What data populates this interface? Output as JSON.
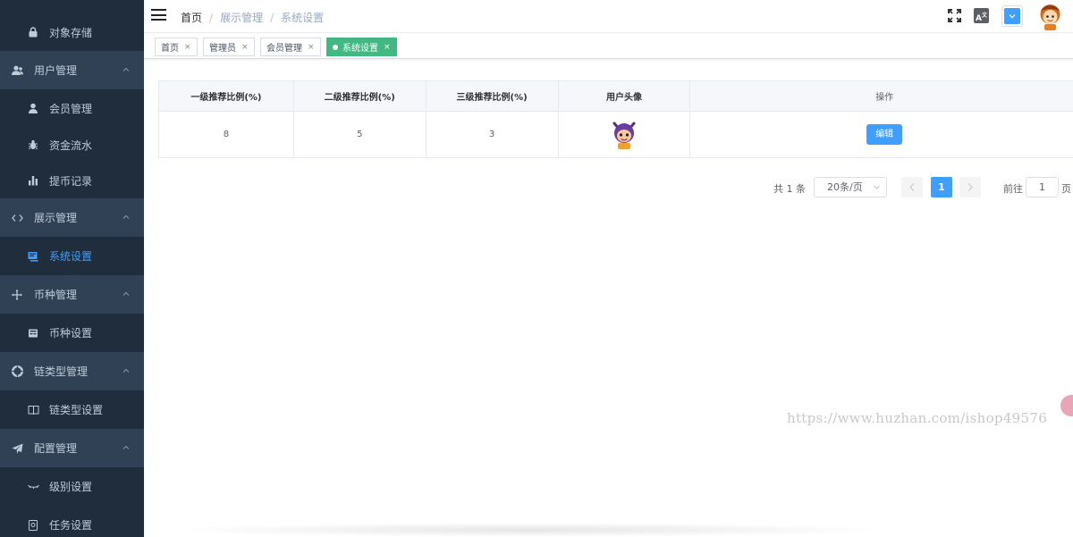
{
  "sidebar": {
    "partial_item": "",
    "items": [
      {
        "type": "sub",
        "label": "对象存储",
        "icon": "lock-icon"
      },
      {
        "type": "group",
        "label": "用户管理",
        "icon": "user-icon"
      },
      {
        "type": "sub",
        "label": "会员管理",
        "icon": "person-icon"
      },
      {
        "type": "sub",
        "label": "资金流水",
        "icon": "bug-icon"
      },
      {
        "type": "sub",
        "label": "提币记录",
        "icon": "bar-chart-icon"
      },
      {
        "type": "group",
        "label": "展示管理",
        "icon": "code-icon"
      },
      {
        "type": "sub",
        "label": "系统设置",
        "icon": "monitor-icon",
        "active": true
      },
      {
        "type": "group",
        "label": "币种管理",
        "icon": "move-icon"
      },
      {
        "type": "sub",
        "label": "币种设置",
        "icon": "card-icon"
      },
      {
        "type": "group",
        "label": "链类型管理",
        "icon": "lifebuoy-icon"
      },
      {
        "type": "sub",
        "label": "链类型设置",
        "icon": "book-icon"
      },
      {
        "type": "group",
        "label": "配置管理",
        "icon": "send-icon"
      },
      {
        "type": "sub",
        "label": "级别设置",
        "icon": "eye-icon"
      },
      {
        "type": "sub",
        "label": "任务设置",
        "icon": "clipboard-icon"
      }
    ]
  },
  "header": {
    "breadcrumb": [
      "首页",
      "展示管理",
      "系统设置"
    ],
    "lang_label": "A",
    "accent_color": "#409eff"
  },
  "tags": [
    {
      "label": "首页",
      "active": false
    },
    {
      "label": "管理员",
      "active": false
    },
    {
      "label": "会员管理",
      "active": false
    },
    {
      "label": "系统设置",
      "active": true
    }
  ],
  "table": {
    "headers": [
      "一级推荐比例(%)",
      "二级推荐比例(%)",
      "三级推荐比例(%)",
      "用户头像",
      "操作"
    ],
    "rows": [
      {
        "level1": "8",
        "level2": "5",
        "level3": "3",
        "avatar": "cartoon-avatar",
        "action": "编辑"
      }
    ]
  },
  "pagination": {
    "total_text": "共 1 条",
    "page_size": "20条/页",
    "current_page": "1",
    "goto_label": "前往",
    "goto_value": "1",
    "page_unit": "页"
  },
  "watermark": "https://www.huzhan.com/ishop49576",
  "colors": {
    "sidebar_bg": "#304156",
    "submenu_bg": "#1f2d3d",
    "active_tag": "#42b983",
    "primary": "#409eff"
  }
}
